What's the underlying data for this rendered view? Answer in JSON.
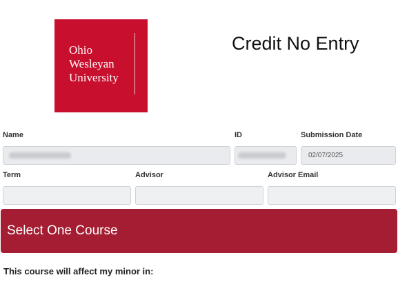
{
  "header": {
    "logo_lines": [
      "Ohio",
      "Wesleyan",
      "University"
    ],
    "title": "Credit No Entry"
  },
  "form": {
    "name": {
      "label": "Name",
      "value": ""
    },
    "id": {
      "label": "ID",
      "value": ""
    },
    "submission_date": {
      "label": "Submission Date",
      "value": "02/07/2025"
    },
    "term": {
      "label": "Term",
      "value": ""
    },
    "advisor": {
      "label": "Advisor",
      "value": ""
    },
    "advisor_email": {
      "label": "Advisor Email",
      "value": ""
    }
  },
  "course_select": {
    "label": "Select One Course"
  },
  "minor_note": "This course will affect my minor in:",
  "colors": {
    "brand_red": "#c8102e",
    "banner_red": "#a51d32",
    "input_bg": "#e9ebee"
  }
}
